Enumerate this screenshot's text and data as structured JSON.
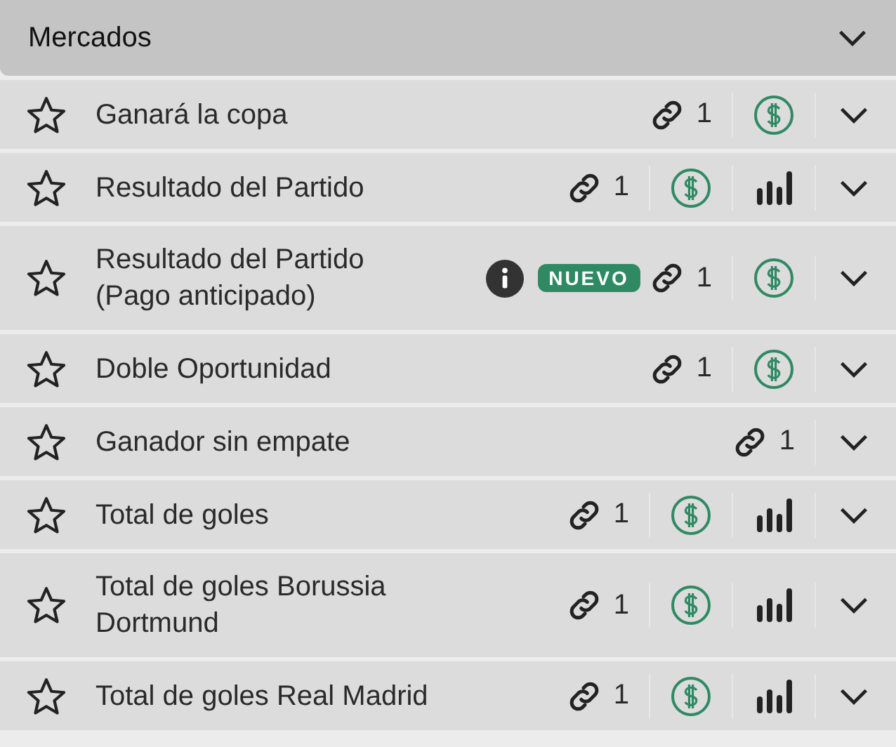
{
  "header": {
    "title": "Mercados",
    "expanded": true
  },
  "markets": [
    {
      "name": "Ganará la copa",
      "favorite": false,
      "info": false,
      "links": "1",
      "cash_out": true,
      "stats": false
    },
    {
      "name": "Resultado del Partido",
      "favorite": false,
      "info": false,
      "links": "1",
      "cash_out": true,
      "stats": true
    },
    {
      "name": "Resultado del Partido (Pago anticipado)",
      "favorite": false,
      "info": true,
      "badge": "NUEVO",
      "links": "1",
      "cash_out": true,
      "stats": false
    },
    {
      "name": "Doble Oportunidad",
      "favorite": false,
      "info": false,
      "links": "1",
      "cash_out": true,
      "stats": false
    },
    {
      "name": "Ganador sin empate",
      "favorite": false,
      "info": false,
      "links": "1",
      "cash_out": false,
      "stats": false
    },
    {
      "name": "Total de goles",
      "favorite": false,
      "info": false,
      "links": "1",
      "cash_out": true,
      "stats": true
    },
    {
      "name": "Total de goles Borussia Dortmund",
      "favorite": false,
      "info": false,
      "links": "1",
      "cash_out": true,
      "stats": true
    },
    {
      "name": "Total de goles Real Madrid",
      "favorite": false,
      "info": false,
      "links": "1",
      "cash_out": true,
      "stats": true
    }
  ]
}
